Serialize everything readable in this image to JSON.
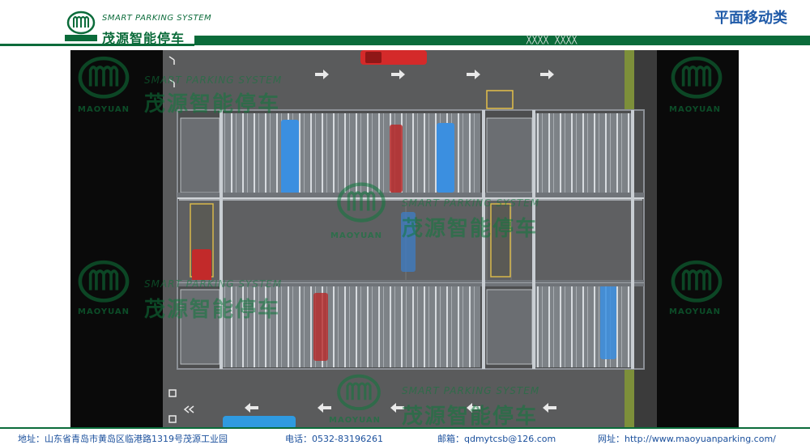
{
  "header": {
    "brand_en": "SMART PARKING SYSTEM",
    "brand_cn": "茂源智能停车",
    "brand_sub": "MAOYUAN",
    "page_title": "平面移动类",
    "deco": "\\\\\\\\\\\\\\\\\\\\\\\\"
  },
  "watermark": {
    "en": "SMART PARKING SYSTEM",
    "cn": "茂源智能停车",
    "mao": "MAOYUAN"
  },
  "footer": {
    "address": "地址：山东省青岛市黄岛区临港路1319号茂源工业园",
    "phone": "电话：0532-83196261",
    "email": "邮箱：qdmytcsb@126.com",
    "website": "网址：http://www.maoyuanparking.com/"
  },
  "colors": {
    "brand_green": "#0b6b3a",
    "title_blue": "#1f5aa8",
    "footer_blue": "#1a4f9c"
  }
}
